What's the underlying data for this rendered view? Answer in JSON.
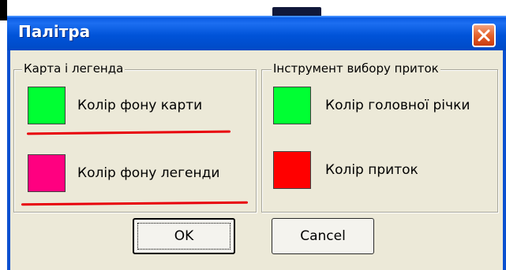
{
  "window": {
    "title": "Палітра",
    "close_icon": "close-icon"
  },
  "map_group": {
    "legend": "Карта і легенда",
    "items": [
      {
        "label": "Колір фону карти",
        "color": "#00ff33"
      },
      {
        "label": "Колір фону легенди",
        "color": "#ff0080"
      }
    ]
  },
  "tool_group": {
    "legend": "Інструмент вибору приток",
    "items": [
      {
        "label": "Колір головної річки",
        "color": "#00ff33"
      },
      {
        "label": "Колір приток",
        "color": "#ff0000"
      }
    ]
  },
  "buttons": {
    "ok_label": "OK",
    "cancel_label": "Cancel"
  },
  "colors": {
    "annotation_underline": "#e8000a",
    "titlebar": "#0053d8"
  }
}
